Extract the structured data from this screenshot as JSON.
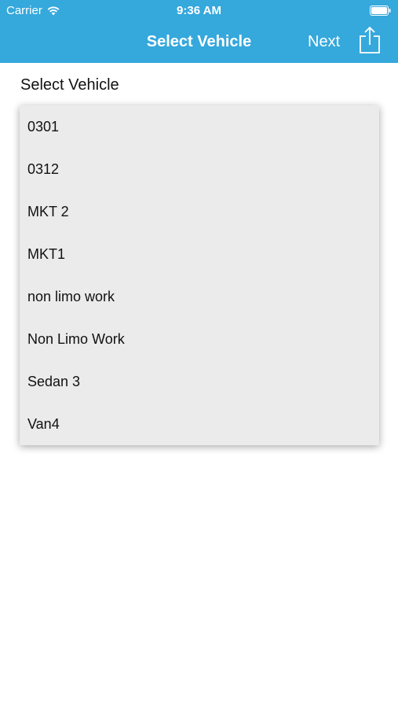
{
  "status_bar": {
    "carrier": "Carrier",
    "time": "9:36 AM"
  },
  "nav": {
    "title": "Select Vehicle",
    "next_label": "Next",
    "share_icon": "share-icon"
  },
  "colors": {
    "header": "#35a8dc",
    "dropdown_bg": "#ebebeb",
    "text": "#111111"
  },
  "main": {
    "label": "Select Vehicle",
    "vehicles": [
      "0301",
      "0312",
      "MKT 2",
      "MKT1",
      "non limo work",
      "Non Limo Work",
      "Sedan 3",
      "Van4"
    ]
  }
}
